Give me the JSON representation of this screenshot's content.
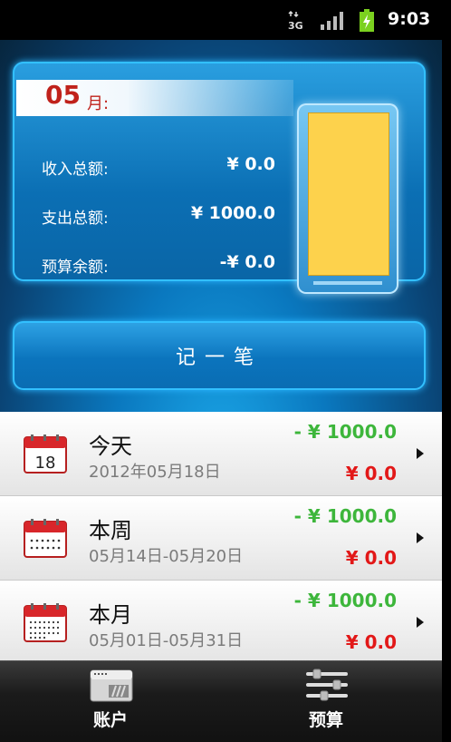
{
  "status_bar": {
    "network": "3G",
    "time": "9:03"
  },
  "summary": {
    "month_number": "05",
    "month_unit": "月:",
    "income_label": "收入总额:",
    "income_value": "¥ 0.0",
    "expense_label": "支出总额:",
    "expense_value": "¥ 1000.0",
    "budget_label": "预算余额:",
    "budget_value": "-¥ 0.0",
    "budget_gauge_fill": 1.0,
    "gauge_color": "#fdd24c"
  },
  "record_button": {
    "label": "记一笔"
  },
  "periods": [
    {
      "title": "今天",
      "date_range": "2012年05月18日",
      "expense": "- ¥ 1000.0",
      "income": "¥ 0.0",
      "icon": "calendar-day-icon",
      "icon_day": "18"
    },
    {
      "title": "本周",
      "date_range": "05月14日-05月20日",
      "expense": "- ¥ 1000.0",
      "income": "¥ 0.0",
      "icon": "calendar-week-icon"
    },
    {
      "title": "本月",
      "date_range": "05月01日-05月31日",
      "expense": "- ¥ 1000.0",
      "income": "¥ 0.0",
      "icon": "calendar-month-icon"
    }
  ],
  "tabs": [
    {
      "label": "账户",
      "icon": "wallet-card-icon"
    },
    {
      "label": "预算",
      "icon": "sliders-icon"
    }
  ],
  "colors": {
    "expense_green": "#3db63b",
    "income_red": "#e21818",
    "month_red": "#c0221b",
    "accent_blue": "#0b74bd"
  }
}
